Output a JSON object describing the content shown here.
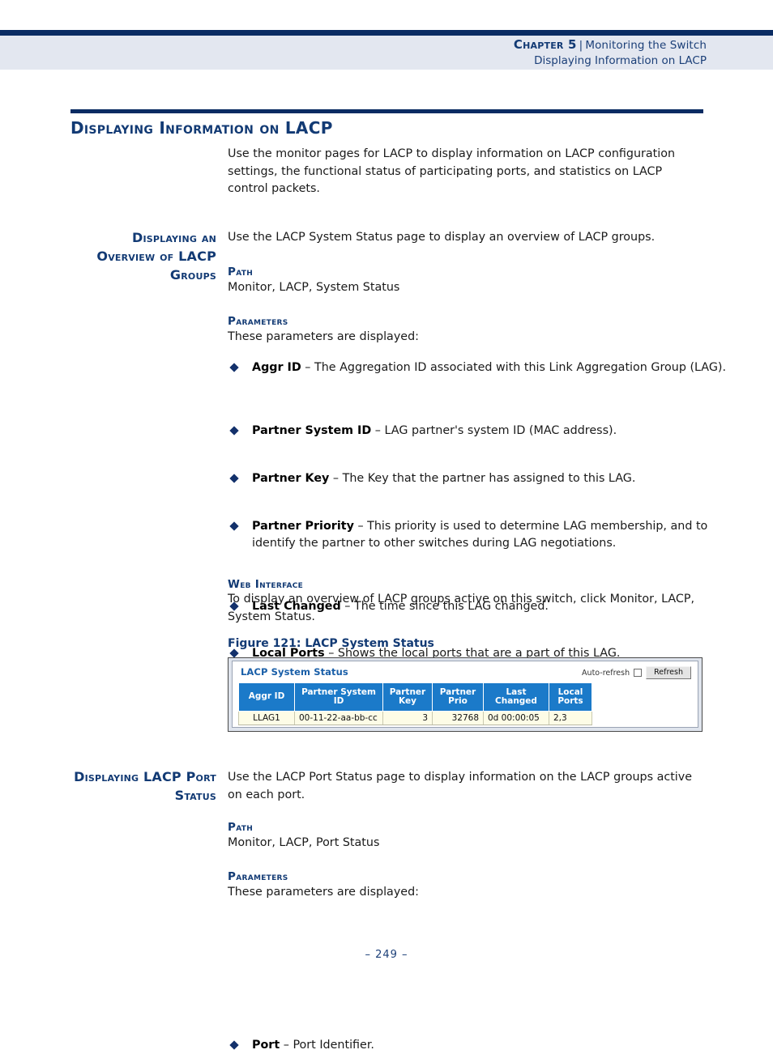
{
  "header": {
    "chapter_label": "Chapter 5",
    "separator": "|",
    "chapter_title": "Monitoring the Switch",
    "section_title": "Displaying Information on LACP"
  },
  "section": {
    "title": "Displaying Information on LACP",
    "intro": "Use the monitor pages for LACP to display information on LACP configuration settings, the functional status of participating ports, and statistics on LACP control packets."
  },
  "subsection_overview": {
    "side_heading": "Displaying an Overview of LACP Groups",
    "intro": "Use the LACP System Status page to display an overview of LACP groups.",
    "path_label": "Path",
    "path_value": "Monitor, LACP, System Status",
    "parameters_label": "Parameters",
    "parameters_intro": "These parameters are displayed:",
    "bullets": [
      {
        "term": "Aggr ID",
        "dash": "–",
        "text": "The Aggregation ID associated with this Link Aggregation Group (LAG)."
      },
      {
        "term": "Partner System ID",
        "dash": "–",
        "text": "LAG partner's system ID (MAC address)."
      },
      {
        "term": "Partner Key",
        "dash": "–",
        "text": "The Key that the partner has assigned to this LAG."
      },
      {
        "term": "Partner Priority",
        "dash": "–",
        "text": "This priority is used to determine LAG membership, and to identify the partner to other switches during LAG negotiations."
      },
      {
        "term": "Last Changed",
        "dash": "–",
        "text": "The time since this LAG changed."
      },
      {
        "term": "Local Ports",
        "dash": "–",
        "text": "Shows the local ports that are a part of this LAG."
      }
    ],
    "web_interface_label": "Web Interface",
    "web_interface_text": "To display an overview of LACP groups active on this switch, click Monitor, LACP, System Status.",
    "figure_caption": "Figure 121:  LACP System Status"
  },
  "figure": {
    "panel_title": "LACP System Status",
    "auto_refresh_label": "Auto-refresh",
    "auto_refresh_checked": false,
    "refresh_button_label": "Refresh",
    "accent_header_color": "#1b7ac9",
    "row_color": "#fdfce6",
    "columns": [
      "Aggr ID",
      "Partner System ID",
      "Partner Key",
      "Partner Prio",
      "Last Changed",
      "Local Ports"
    ],
    "rows": [
      {
        "aggr_id": "LLAG1",
        "partner_system_id": "00-11-22-aa-bb-cc",
        "partner_key": "3",
        "partner_prio": "32768",
        "last_changed": "0d 00:00:05",
        "local_ports": "2,3"
      }
    ]
  },
  "subsection_port_status": {
    "side_heading": "Displaying LACP Port Status",
    "intro": "Use the LACP Port Status page to display information on the LACP groups active on each port.",
    "path_label": "Path",
    "path_value": "Monitor, LACP, Port Status",
    "parameters_label": "Parameters",
    "parameters_intro": "These parameters are displayed:",
    "bullets": [
      {
        "term": "Port",
        "dash": "–",
        "text": "Port Identifier."
      }
    ]
  },
  "footer": {
    "page_number": "–  249  –"
  }
}
